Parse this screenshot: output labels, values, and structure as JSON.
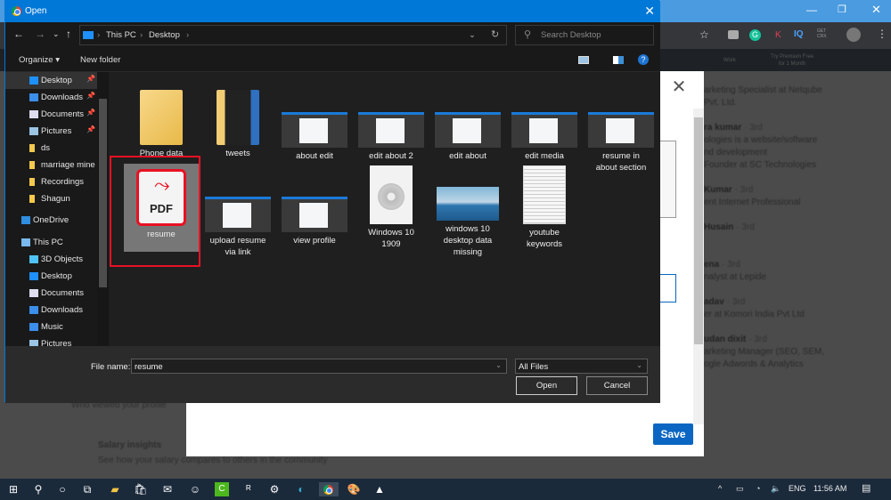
{
  "dialog": {
    "title": "Open",
    "breadcrumb": [
      "This PC",
      "Desktop"
    ],
    "search_placeholder": "Search Desktop",
    "toolbar": {
      "organize": "Organize",
      "new_folder": "New folder"
    },
    "sidebar": [
      {
        "label": "Desktop",
        "icon": "desktop-icon",
        "pinned": true,
        "selected": true
      },
      {
        "label": "Downloads",
        "icon": "download-icon",
        "pinned": true
      },
      {
        "label": "Documents",
        "icon": "documents-icon",
        "pinned": true
      },
      {
        "label": "Pictures",
        "icon": "pictures-icon",
        "pinned": true
      },
      {
        "label": "ds",
        "icon": "folder-icon"
      },
      {
        "label": "marriage mine",
        "icon": "folder-icon"
      },
      {
        "label": "Recordings",
        "icon": "folder-icon"
      },
      {
        "label": "Shagun",
        "icon": "folder-icon"
      },
      {
        "label": "OneDrive",
        "icon": "cloud-icon"
      },
      {
        "label": "This PC",
        "icon": "computer-icon"
      },
      {
        "label": "3D Objects",
        "icon": "cube-icon"
      },
      {
        "label": "Desktop",
        "icon": "desktop-icon"
      },
      {
        "label": "Documents",
        "icon": "documents-icon"
      },
      {
        "label": "Downloads",
        "icon": "download-icon"
      },
      {
        "label": "Music",
        "icon": "music-icon"
      },
      {
        "label": "Pictures",
        "icon": "pictures-icon"
      }
    ],
    "files": [
      {
        "name": "Phone data",
        "type": "folder"
      },
      {
        "name": "tweets",
        "type": "folder"
      },
      {
        "name": "about edit",
        "type": "screenshot"
      },
      {
        "name": "edit about 2",
        "type": "screenshot"
      },
      {
        "name": "edit about",
        "type": "screenshot"
      },
      {
        "name": "edit media",
        "type": "screenshot"
      },
      {
        "name": "resume in about section",
        "type": "screenshot"
      },
      {
        "name": "resume",
        "type": "pdf",
        "selected": true,
        "badge": "PDF"
      },
      {
        "name": "upload resume via link",
        "type": "screenshot"
      },
      {
        "name": "view profile",
        "type": "screenshot"
      },
      {
        "name": "Windows 10 1909",
        "type": "disc-image"
      },
      {
        "name": "windows 10 desktop data missing",
        "type": "landscape"
      },
      {
        "name": "youtube keywords",
        "type": "text"
      }
    ],
    "file_name_label": "File name:",
    "file_name_value": "resume",
    "file_type": "All Files",
    "open_label": "Open",
    "cancel_label": "Cancel"
  },
  "background": {
    "save_label": "Save",
    "people": [
      {
        "name": "",
        "lines": [
          "arketing Specialist at Netqube",
          "Pvt. Ltd."
        ]
      },
      {
        "name": "ra kumar",
        "degree": "· 3rd",
        "lines": [
          "ologies is a website/software",
          "nd development",
          "Founder at SC Technologies"
        ]
      },
      {
        "name": "Kumar",
        "degree": "· 3rd",
        "lines": [
          "ent Internet Professional"
        ]
      },
      {
        "name": "Husain",
        "degree": "· 3rd",
        "lines": [
          ""
        ]
      },
      {
        "name": "ena",
        "degree": "· 3rd",
        "lines": [
          "nalyst at Lepide"
        ]
      },
      {
        "name": "adav",
        "degree": "· 3rd",
        "lines": [
          "er at Komori India Pvt Ltd"
        ]
      },
      {
        "name": "udan dixit",
        "degree": "· 3rd",
        "lines": [
          "arketing Manager (SEO, SEM,",
          "ogle Adwords & Analytics"
        ]
      }
    ],
    "left_items": [
      "Who viewed your profile",
      "Salary insights",
      "See how your salary compares to others in the community"
    ],
    "premium": [
      "Try Premium Free",
      "for 1 Month"
    ],
    "work": "Work"
  },
  "taskbar": {
    "language": "ENG",
    "time": "11:56 AM"
  },
  "colors": {
    "accent": "#0078d7",
    "selection_outline": "#e81123",
    "linkedin_blue": "#0a66c2"
  }
}
